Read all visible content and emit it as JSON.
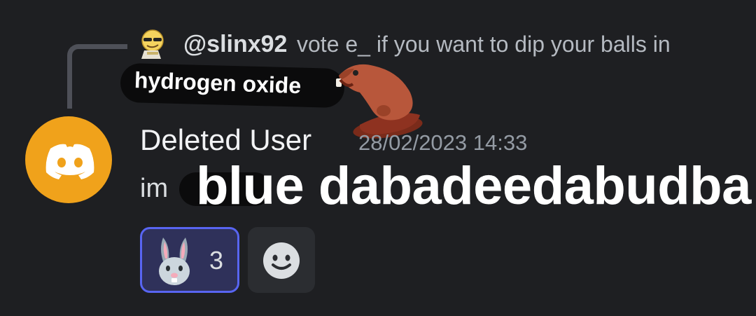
{
  "reply": {
    "username": "@slinx92",
    "text": "vote e_ if you want to dip your balls in",
    "avatar_icon": "emoji-face-avatar-icon"
  },
  "sticker": {
    "text": "hydrogen oxide",
    "image_icon": "beaver-icon"
  },
  "message": {
    "author": "Deleted User",
    "timestamp": "28/02/2023 14:33",
    "prefix": "im",
    "big_text": "blue dabadeedabudba",
    "avatar_icon": "discord-logo-icon",
    "avatar_color": "#f0a21b"
  },
  "reactions": [
    {
      "emoji_icon": "rabbit-face-icon",
      "count": "3",
      "active": true
    }
  ],
  "add_reaction": {
    "icon": "smiley-add-reaction-icon"
  },
  "colors": {
    "background": "#1e1f22",
    "accent": "#5865f2",
    "muted": "#949ba4"
  }
}
